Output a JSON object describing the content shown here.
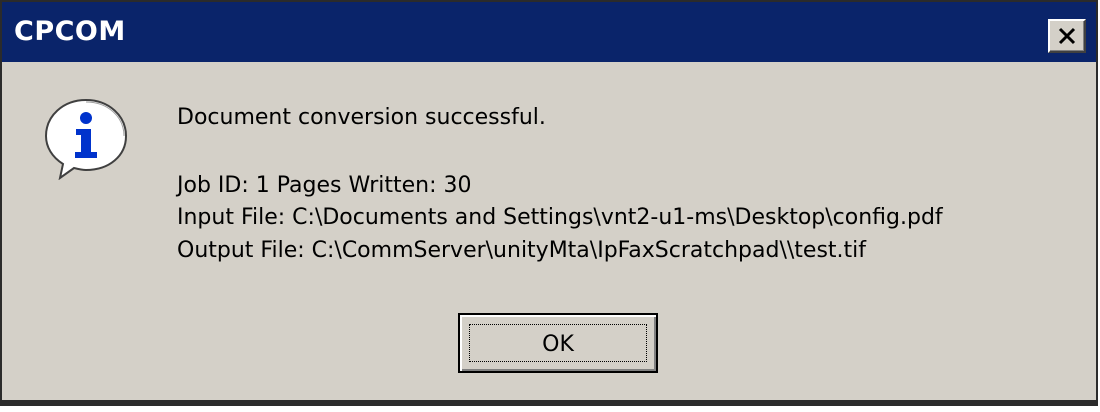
{
  "window": {
    "title": "CPCOM"
  },
  "message": {
    "headline": "Document conversion successful.",
    "lines": [
      "Job ID: 1 Pages Written: 30",
      "Input File: C:\\Documents and Settings\\vnt2-u1-ms\\Desktop\\config.pdf",
      "Output File: C:\\CommServer\\unityMta\\IpFaxScratchpad\\\\test.tif"
    ]
  },
  "buttons": {
    "ok_label": "OK"
  },
  "icons": {
    "message_icon": "info-icon",
    "close_icon": "close-icon"
  },
  "colors": {
    "titlebar": "#0a246a",
    "dialog_bg": "#d4d0c8",
    "info_blue": "#0033cc"
  }
}
